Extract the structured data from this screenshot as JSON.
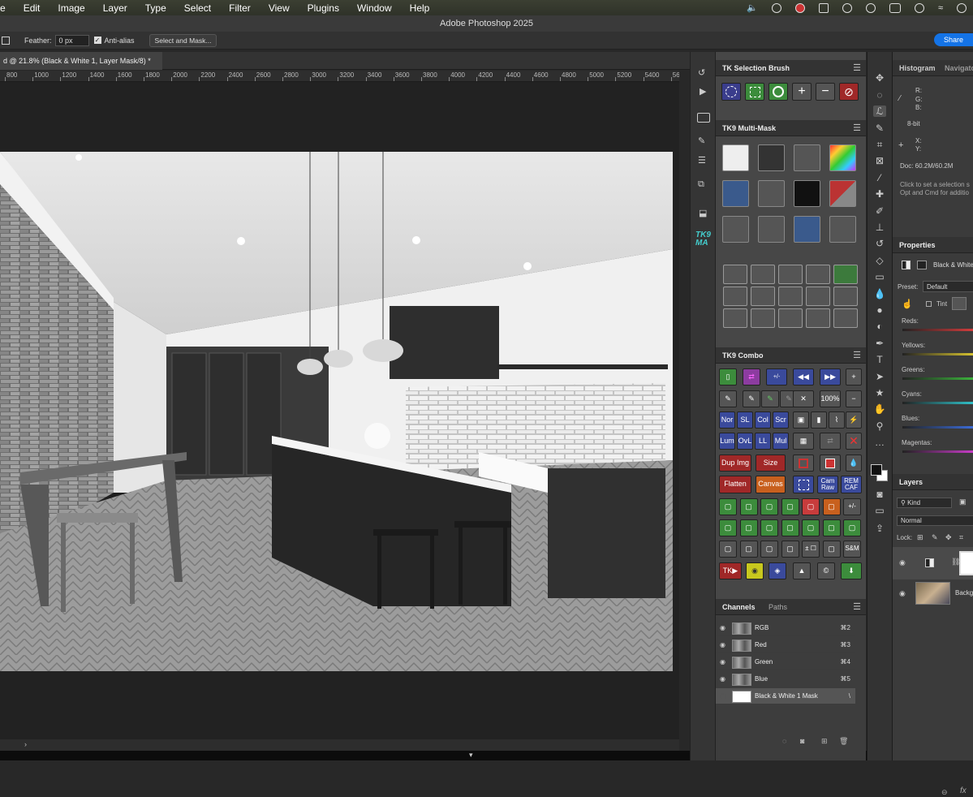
{
  "menubar": {
    "items": [
      "e",
      "Edit",
      "Image",
      "Layer",
      "Type",
      "Select",
      "Filter",
      "View",
      "Plugins",
      "Window",
      "Help"
    ]
  },
  "app_title": "Adobe Photoshop 2025",
  "options": {
    "feather_label": "Feather:",
    "feather_value": "0 px",
    "antialias_label": "Anti-alias",
    "antialias_checked": true,
    "select_mask_label": "Select and Mask...",
    "share_label": "Share"
  },
  "document_tab": "d @ 21.8% (Black & White 1, Layer Mask/8) *",
  "ruler_ticks": [
    "800",
    "1000",
    "1200",
    "1400",
    "1600",
    "1800",
    "2000",
    "2200",
    "2400",
    "2600",
    "2800",
    "3000",
    "3200",
    "3400",
    "3600",
    "3800",
    "4000",
    "4200",
    "4400",
    "4600",
    "4800",
    "5000",
    "5200",
    "5400",
    "56"
  ],
  "tk_selection": {
    "title": "TK Selection Brush",
    "buttons": [
      "select-ellipse",
      "select-rect",
      "select-round",
      "plus",
      "minus",
      "no"
    ]
  },
  "tk9_multimask": {
    "title": "TK9 Multi-Mask"
  },
  "tk9_combo": {
    "title": "TK9 Combo",
    "text_buttons": {
      "pct": "100%",
      "nor": "Nor",
      "sl": "SL",
      "col": "Col",
      "scr": "Scr",
      "lum": "Lum",
      "ovl": "OvL",
      "ll": "LL",
      "mul": "Mul",
      "dup": "Dup Img",
      "size": "Size",
      "flatten": "Flatten",
      "canvas": "Canvas",
      "camraw": "Cam Raw",
      "remcaf": "REM CAF",
      "pm": "+/-",
      "sm": "S&M",
      "tk": "TK▶",
      "pmsq": "± ☐"
    }
  },
  "channels": {
    "tab_active": "Channels",
    "tab_other": "Paths",
    "rows": [
      {
        "name": "RGB",
        "shortcut": "⌘2"
      },
      {
        "name": "Red",
        "shortcut": "⌘3"
      },
      {
        "name": "Green",
        "shortcut": "⌘4"
      },
      {
        "name": "Blue",
        "shortcut": "⌘5"
      },
      {
        "name": "Black & White 1 Mask",
        "shortcut": "\\"
      }
    ]
  },
  "histogram": {
    "tab1": "Histogram",
    "tab2": "Navigato",
    "r": "R:",
    "g": "G:",
    "b": "B:",
    "bit": "8-bit",
    "x": "X:",
    "y": "Y:",
    "doc": "Doc: 60.2M/60.2M",
    "hint1": "Click to set a selection s",
    "hint2": "Opt and Cmd for additio"
  },
  "properties": {
    "title": "Properties",
    "layer_name": "Black & White",
    "preset_label": "Preset:",
    "preset_value": "Default",
    "tint_label": "Tint",
    "sliders": [
      "Reds:",
      "Yellows:",
      "Greens:",
      "Cyans:",
      "Blues:",
      "Magentas:"
    ],
    "slider_colors": [
      "#d43c3c",
      "#d8c430",
      "#3cb43c",
      "#30c0c8",
      "#3c6cd8",
      "#c83cc8"
    ]
  },
  "layers": {
    "title": "Layers",
    "kind": "Kind",
    "blend": "Normal",
    "lock_label": "Lock:",
    "bg_layer": "Backg"
  }
}
